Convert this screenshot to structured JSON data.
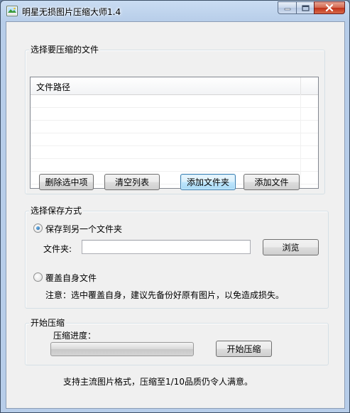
{
  "window": {
    "title": "明星无损图片压缩大师1.4",
    "icon": "app-image-icon",
    "caption_buttons": [
      "minimize-icon",
      "maximize-icon",
      "close-icon"
    ]
  },
  "file_group": {
    "title": "选择要压缩的文件",
    "list": {
      "columns": [
        "文件路径"
      ],
      "rows": []
    },
    "buttons": {
      "remove_selected": "删除选中项",
      "clear_list": "清空列表",
      "add_folder": "添加文件夹",
      "add_file": "添加文件"
    }
  },
  "save_group": {
    "title": "选择保存方式",
    "option_other_folder": {
      "label": "保存到另一个文件夹",
      "checked": true
    },
    "folder_label": "文件夹:",
    "folder_value": "",
    "browse_button": "浏览",
    "option_overwrite": {
      "label": "覆盖自身文件",
      "checked": false
    },
    "note": "注意：选中覆盖自身，建议先备份好原有图片，以免造成损失。"
  },
  "compress_group": {
    "title": "开始压缩",
    "progress_label": "压缩进度：",
    "progress_fraction": 0,
    "start_button": "开始压缩"
  },
  "footer": {
    "text": "支持主流图片格式，压缩至1/10品质仍令人满意。"
  }
}
